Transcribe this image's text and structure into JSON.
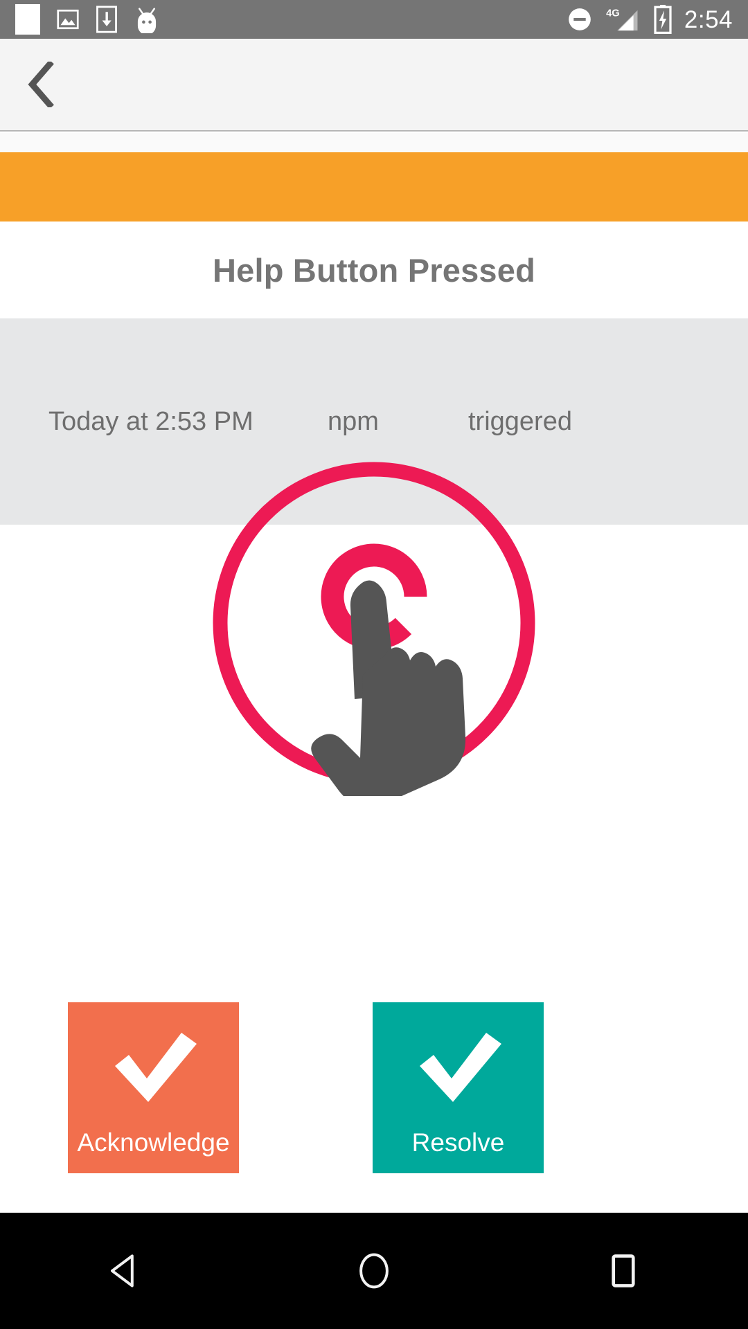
{
  "status_bar": {
    "time": "2:54",
    "network_label": "4G",
    "left_icons": [
      {
        "name": "blank-notification-icon"
      },
      {
        "name": "image-icon"
      },
      {
        "name": "download-to-device-icon"
      },
      {
        "name": "android-head-icon"
      }
    ],
    "right_icons": [
      {
        "name": "do-not-disturb-icon"
      },
      {
        "name": "signal-4g-icon"
      },
      {
        "name": "battery-charging-icon"
      }
    ],
    "background_color": "#757575"
  },
  "app_bar": {
    "back_label": "‹"
  },
  "severity": {
    "color": "#f7a028"
  },
  "alert": {
    "title": "Help Button Pressed",
    "timestamp": "Today at 2:53 PM",
    "source": "npm",
    "status": "triggered"
  },
  "hero_icon": {
    "name": "tap-gesture-icon",
    "ring_color": "#ed1a54",
    "hand_color": "#555555"
  },
  "actions": [
    {
      "key": "acknowledge",
      "label": "Acknowledge",
      "color": "#f26f4d",
      "icon": "check-icon"
    },
    {
      "key": "resolve",
      "label": "Resolve",
      "color": "#00a99b",
      "icon": "check-icon"
    }
  ],
  "nav_bar": {
    "back": "back-triangle-icon",
    "home": "home-circle-icon",
    "recents": "recents-square-icon"
  }
}
